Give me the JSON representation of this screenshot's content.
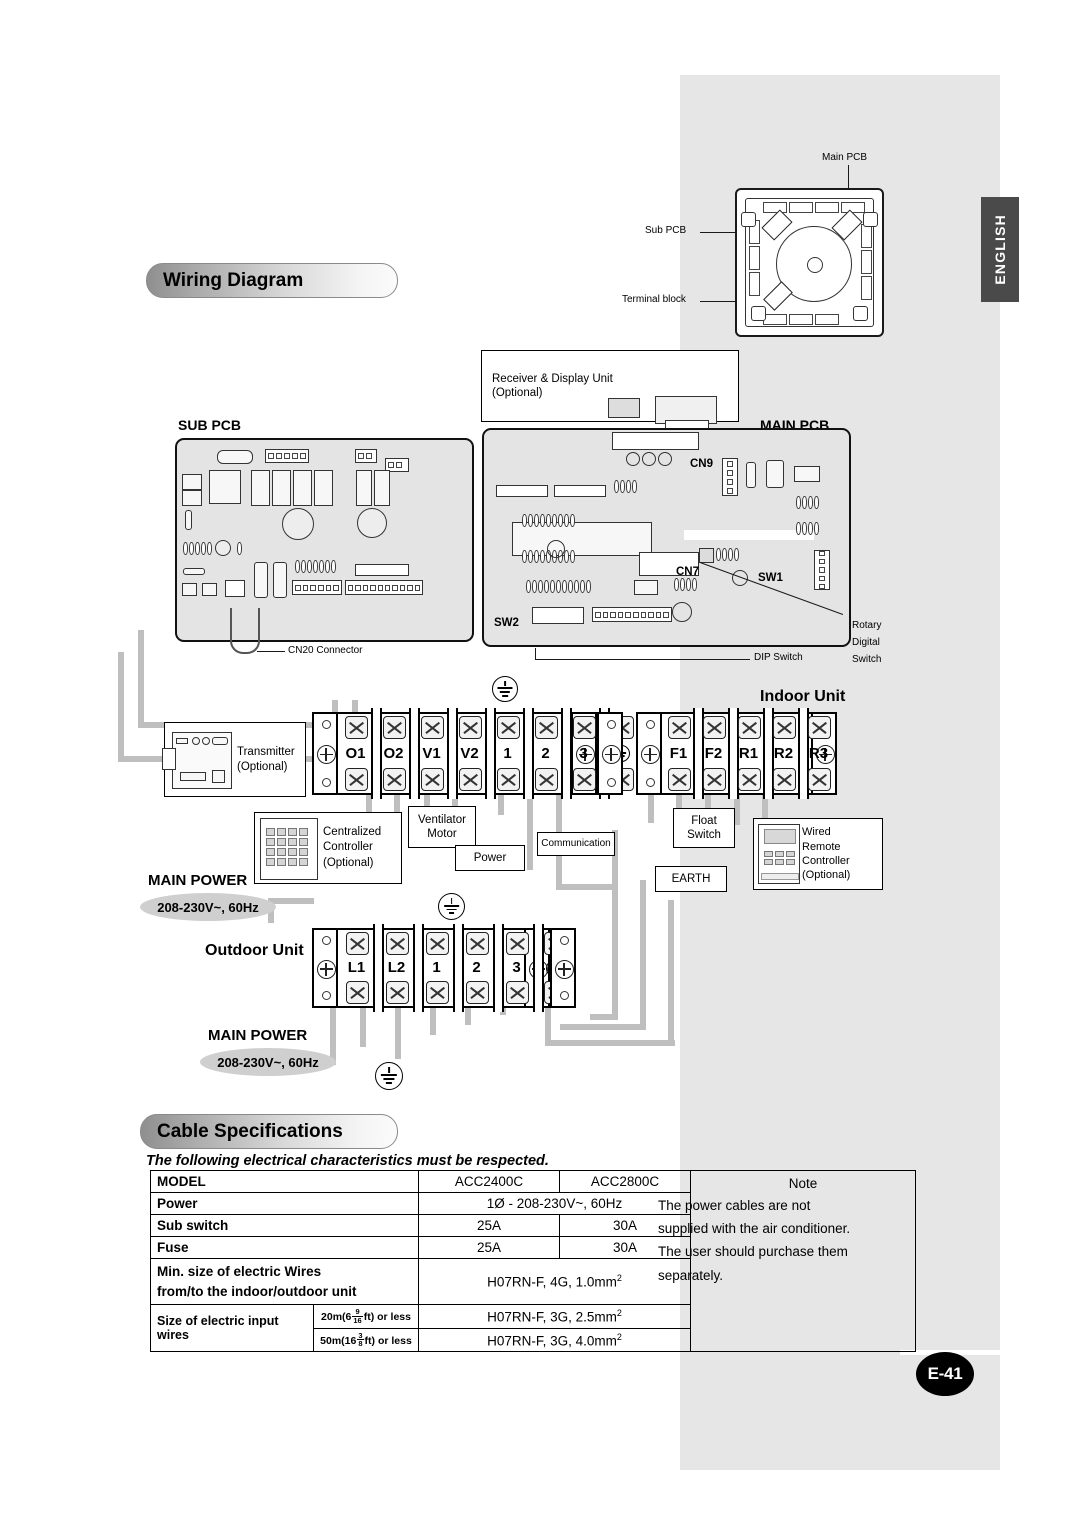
{
  "page": {
    "language_tab": "ENGLISH",
    "page_number": "E-41"
  },
  "sections": {
    "wiring_title": "Wiring Diagram",
    "cable_title": "Cable Specifications",
    "cable_intro": "The following electrical characteristics must be respected."
  },
  "unit_illustration": {
    "main_pcb_label": "Main PCB",
    "sub_pcb_label": "Sub PCB",
    "terminal_block_label": "Terminal block"
  },
  "pcb": {
    "sub_pcb_title": "SUB PCB",
    "main_pcb_title": "MAIN PCB",
    "receiver_line1": "Receiver & Display Unit",
    "receiver_line2": "(Optional)",
    "cn20_label": "CN20 Connector",
    "cn9_label": "CN9",
    "cn7_label": "CN7",
    "sw1_label": "SW1",
    "sw2_label": "SW2",
    "dip_switch_label": "DIP Switch",
    "rotary_line1": "Rotary",
    "rotary_line2": "Digital",
    "rotary_line3": "Switch"
  },
  "indoor": {
    "heading": "Indoor Unit",
    "terminals_left": [
      "O1",
      "O2",
      "V1",
      "V2",
      "1",
      "2",
      "3",
      "earth"
    ],
    "terminals_right": [
      "F1",
      "F2",
      "R1",
      "R2",
      "R3"
    ],
    "transmitter_l1": "Transmitter",
    "transmitter_l2": "(Optional)",
    "centralized_l1": "Centralized",
    "centralized_l2": "Controller",
    "centralized_l3": "(Optional)",
    "ventilator_l1": "Ventilator",
    "ventilator_l2": "Motor",
    "power_callout": "Power",
    "communication_callout": "Communication",
    "float_l1": "Float",
    "float_l2": "Switch",
    "earth_callout": "EARTH",
    "wired_rc_l1": "Wired",
    "wired_rc_l2": "Remote",
    "wired_rc_l3": "Controller",
    "wired_rc_l4": "(Optional)",
    "main_power_label": "MAIN POWER",
    "main_power_value": "208-230V~, 60Hz"
  },
  "outdoor": {
    "heading": "Outdoor Unit",
    "terminals": [
      "L1",
      "L2",
      "1",
      "2",
      "3",
      "earth"
    ],
    "main_power_label": "MAIN POWER",
    "main_power_value": "208-230V~, 60Hz"
  },
  "spec_table": {
    "headers": [
      "MODEL",
      "ACC2400C",
      "ACC2800C",
      "Note"
    ],
    "rows": [
      {
        "label": "Power",
        "value_span": "1Ø - 208-230V~, 60Hz"
      },
      {
        "label": "Sub switch",
        "v1": "25A",
        "v2": "30A"
      },
      {
        "label": "Fuse",
        "v1": "25A",
        "v2": "30A"
      },
      {
        "label_line1": "Min. size of electric Wires",
        "label_line2": "from/to the indoor/outdoor unit",
        "value_span": "H07RN-F, 4G, 1.0mm"
      }
    ],
    "input_wires_label": "Size of electric input wires",
    "input_wires": [
      {
        "cond_pre": "20m(6",
        "cond_num": "9",
        "cond_den": "16",
        "cond_post": "ft) or less",
        "value": "H07RN-F, 3G, 2.5mm"
      },
      {
        "cond_pre": "50m(16",
        "cond_num": "3",
        "cond_den": "8",
        "cond_post": "ft) or less",
        "value": "H07RN-F, 3G, 4.0mm"
      }
    ],
    "note_lines": [
      "The power cables are not",
      "supplied with the air conditioner.",
      "The user should purchase them",
      "separately."
    ],
    "superscript": "2"
  }
}
